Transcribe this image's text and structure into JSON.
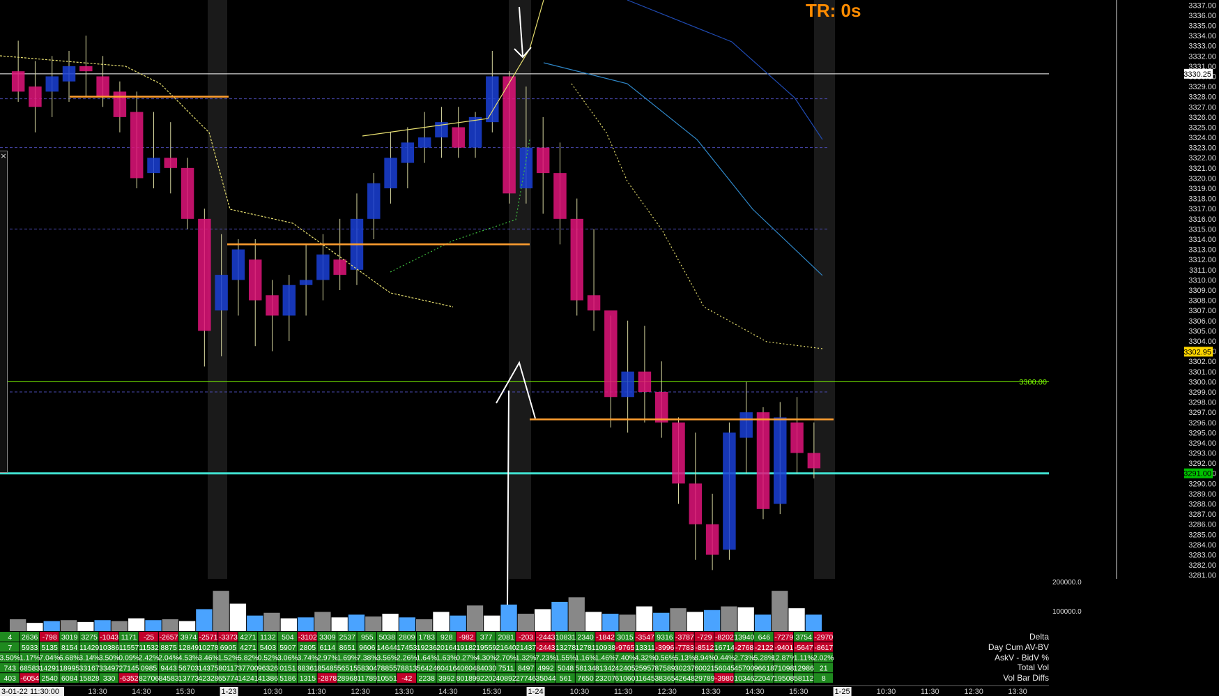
{
  "tr_label": "TR: 0s",
  "window_close_glyph": "×",
  "chart_data": {
    "type": "footprint_candlestick",
    "instrument_price_axis": {
      "ylim": [
        3280.5,
        3337.5
      ],
      "ticks": [
        "3337.00",
        "3336.00",
        "3335.00",
        "3334.00",
        "3333.00",
        "3332.00",
        "3331.00",
        "3330.00",
        "3329.00",
        "3328.00",
        "3327.00",
        "3326.00",
        "3325.00",
        "3324.00",
        "3323.00",
        "3322.00",
        "3321.00",
        "3320.00",
        "3319.00",
        "3318.00",
        "3317.00",
        "3316.00",
        "3315.00",
        "3314.00",
        "3313.00",
        "3312.00",
        "3311.00",
        "3310.00",
        "3309.00",
        "3308.00",
        "3307.00",
        "3306.00",
        "3305.00",
        "3304.00",
        "3303.00",
        "3302.00",
        "3301.00",
        "3300.00",
        "3299.00",
        "3298.00",
        "3297.00",
        "3296.00",
        "3295.00",
        "3294.00",
        "3293.00",
        "3292.00",
        "3291.00",
        "3290.00",
        "3289.00",
        "3288.00",
        "3287.00",
        "3286.00",
        "3285.00",
        "3284.00",
        "3283.00",
        "3282.00",
        "3281.00"
      ],
      "highlighted": [
        {
          "label": "3330.25",
          "value": 3330.25,
          "color": "#ffffff",
          "text_color": "#000000"
        },
        {
          "label": "3302.95",
          "value": 3302.95,
          "color": "#ffd700",
          "text_color": "#000000"
        },
        {
          "label": "3291.00",
          "value": 3291.0,
          "color": "#00c000",
          "text_color": "#000000"
        }
      ]
    },
    "volume_axis": {
      "ticks": [
        "200000.0",
        "100000.0"
      ]
    },
    "horizontal_levels": [
      {
        "label": "3300.00",
        "value": 3300.0,
        "color": "#7cfc00"
      },
      {
        "label": "",
        "value": 3291.0,
        "color": "#40e0d0"
      },
      {
        "label": "",
        "value": 3330.25,
        "color": "#ffffff"
      }
    ],
    "time_axis": [
      "3-01-22 11:30:00",
      "13:30",
      "14:30",
      "15:30",
      "1-23",
      "10:30",
      "11:30",
      "12:30",
      "13:30",
      "14:30",
      "15:30",
      "1-24",
      "10:30",
      "11:30",
      "12:30",
      "13:30",
      "14:30",
      "15:30",
      "1-25",
      "10:30",
      "11:30",
      "12:30",
      "13:30"
    ],
    "candles": [
      {
        "o": 3330.5,
        "h": 3333.5,
        "c": 3328.5,
        "l": 3327.5
      },
      {
        "o": 3329.0,
        "h": 3331.5,
        "c": 3327.0,
        "l": 3324.5
      },
      {
        "o": 3328.5,
        "h": 3332.0,
        "c": 3330.0,
        "l": 3326.0
      },
      {
        "o": 3329.5,
        "h": 3332.5,
        "c": 3331.0,
        "l": 3327.5
      },
      {
        "o": 3331.0,
        "h": 3334.0,
        "c": 3330.5,
        "l": 3328.0
      },
      {
        "o": 3330.0,
        "h": 3332.0,
        "c": 3328.0,
        "l": 3327.0
      },
      {
        "o": 3328.5,
        "h": 3329.5,
        "c": 3326.0,
        "l": 3324.5
      },
      {
        "o": 3326.5,
        "h": 3328.5,
        "c": 3320.0,
        "l": 3319.0
      },
      {
        "o": 3320.5,
        "h": 3326.5,
        "c": 3322.0,
        "l": 3319.0
      },
      {
        "o": 3322.0,
        "h": 3325.5,
        "c": 3321.0,
        "l": 3318.5
      },
      {
        "o": 3321.0,
        "h": 3322.0,
        "c": 3316.0,
        "l": 3315.0
      },
      {
        "o": 3316.0,
        "h": 3317.0,
        "c": 3305.0,
        "l": 3301.5
      },
      {
        "o": 3307.0,
        "h": 3314.5,
        "c": 3310.5,
        "l": 3302.5
      },
      {
        "o": 3310.0,
        "h": 3314.0,
        "c": 3313.0,
        "l": 3306.5
      },
      {
        "o": 3312.0,
        "h": 3314.0,
        "c": 3308.0,
        "l": 3303.5
      },
      {
        "o": 3308.5,
        "h": 3310.0,
        "c": 3306.5,
        "l": 3303.0
      },
      {
        "o": 3306.5,
        "h": 3310.5,
        "c": 3309.5,
        "l": 3304.0
      },
      {
        "o": 3309.5,
        "h": 3313.5,
        "c": 3310.0,
        "l": 3306.5
      },
      {
        "o": 3310.0,
        "h": 3314.5,
        "c": 3312.5,
        "l": 3308.0
      },
      {
        "o": 3312.0,
        "h": 3316.0,
        "c": 3310.5,
        "l": 3309.0
      },
      {
        "o": 3311.0,
        "h": 3318.5,
        "c": 3316.0,
        "l": 3309.5
      },
      {
        "o": 3316.0,
        "h": 3320.5,
        "c": 3319.5,
        "l": 3314.0
      },
      {
        "o": 3319.0,
        "h": 3324.5,
        "c": 3322.0,
        "l": 3317.5
      },
      {
        "o": 3321.5,
        "h": 3325.0,
        "c": 3323.5,
        "l": 3319.0
      },
      {
        "o": 3323.0,
        "h": 3326.5,
        "c": 3324.0,
        "l": 3321.5
      },
      {
        "o": 3324.0,
        "h": 3327.0,
        "c": 3325.5,
        "l": 3322.0
      },
      {
        "o": 3325.0,
        "h": 3327.0,
        "c": 3323.0,
        "l": 3322.0
      },
      {
        "o": 3323.0,
        "h": 3326.5,
        "c": 3326.0,
        "l": 3322.0
      },
      {
        "o": 3325.5,
        "h": 3332.5,
        "c": 3330.0,
        "l": 3324.5
      },
      {
        "o": 3330.0,
        "h": 3330.5,
        "c": 3318.5,
        "l": 3317.5
      },
      {
        "o": 3319.0,
        "h": 3329.0,
        "c": 3323.0,
        "l": 3317.5
      },
      {
        "o": 3323.0,
        "h": 3326.0,
        "c": 3320.5,
        "l": 3316.5
      },
      {
        "o": 3320.5,
        "h": 3323.5,
        "c": 3316.0,
        "l": 3313.5
      },
      {
        "o": 3316.0,
        "h": 3318.0,
        "c": 3308.0,
        "l": 3306.5
      },
      {
        "o": 3308.5,
        "h": 3315.0,
        "c": 3307.0,
        "l": 3305.0
      },
      {
        "o": 3307.0,
        "h": 3306.5,
        "c": 3298.5,
        "l": 3295.5
      },
      {
        "o": 3298.5,
        "h": 3306.0,
        "c": 3301.0,
        "l": 3295.0
      },
      {
        "o": 3301.0,
        "h": 3305.5,
        "c": 3299.0,
        "l": 3296.0
      },
      {
        "o": 3299.0,
        "h": 3302.0,
        "c": 3296.0,
        "l": 3294.5
      },
      {
        "o": 3296.0,
        "h": 3296.5,
        "c": 3290.0,
        "l": 3288.0
      },
      {
        "o": 3290.0,
        "h": 3295.0,
        "c": 3286.0,
        "l": 3282.5
      },
      {
        "o": 3286.0,
        "h": 3289.0,
        "c": 3283.0,
        "l": 3281.5
      },
      {
        "o": 3283.5,
        "h": 3296.0,
        "c": 3295.0,
        "l": 3282.5
      },
      {
        "o": 3294.5,
        "h": 3300.0,
        "c": 3297.0,
        "l": 3291.0
      },
      {
        "o": 3297.0,
        "h": 3297.5,
        "c": 3287.5,
        "l": 3286.5
      },
      {
        "o": 3288.0,
        "h": 3298.0,
        "c": 3296.5,
        "l": 3287.0
      },
      {
        "o": 3296.0,
        "h": 3298.5,
        "c": 3293.0,
        "l": 3291.0
      },
      {
        "o": 3293.0,
        "h": 3296.0,
        "c": 3291.5,
        "l": 3290.5
      }
    ],
    "volume_bars": [
      0.13,
      0.09,
      0.11,
      0.12,
      0.1,
      0.12,
      0.11,
      0.14,
      0.12,
      0.13,
      0.11,
      0.24,
      0.44,
      0.3,
      0.17,
      0.2,
      0.14,
      0.15,
      0.21,
      0.15,
      0.18,
      0.16,
      0.19,
      0.15,
      0.13,
      0.21,
      0.17,
      0.28,
      0.17,
      0.29,
      0.19,
      0.24,
      0.32,
      0.37,
      0.21,
      0.19,
      0.18,
      0.27,
      0.2,
      0.25,
      0.21,
      0.23,
      0.27,
      0.26,
      0.18,
      0.44,
      0.25,
      0.18
    ],
    "stats_rows": [
      {
        "label": "Delta",
        "values": [
          "4",
          "2636",
          "-798",
          "3019",
          "3275",
          "-1043",
          "1171",
          "-25",
          "-2657",
          "3974",
          "-2571",
          "-3373",
          "4271",
          "1132",
          "504",
          "-3102",
          "3309",
          "2537",
          "955",
          "5038",
          "2809",
          "1783",
          "928",
          "-982",
          "377",
          "2081",
          "-203",
          "-2443",
          "10831",
          "2340",
          "-1842",
          "3015",
          "-3547",
          "9316",
          "-3787",
          "-729",
          "-8202",
          "13940",
          "646",
          "-7279",
          "3754",
          "-2970"
        ]
      },
      {
        "label": "Day Cum AV-BV",
        "values": [
          "7",
          "5933",
          "5135",
          "8154",
          "11429",
          "10386",
          "11557",
          "11532",
          "8875",
          "12849",
          "10278",
          "6905",
          "4271",
          "5403",
          "5907",
          "2805",
          "6114",
          "8651",
          "9606",
          "14644",
          "17453",
          "19236",
          "20164",
          "19182",
          "19559",
          "21640",
          "21437",
          "-2443",
          "13278",
          "12781",
          "10938",
          "-9765",
          "13311",
          "-3996",
          "-7783",
          "-8512",
          "16714",
          "-2768",
          "-2122",
          "-9401",
          "-5647",
          "-8617"
        ]
      },
      {
        "label": "AskV - BidV %",
        "values": [
          "3.50%",
          "1.17%",
          "7.04%",
          "6.68%",
          "3.14%",
          "3.50%",
          "0.09%",
          "2.42%",
          "2.04%",
          "4.53%",
          "3.46%",
          "1.52%",
          "5.82%",
          "0.52%",
          "3.06%",
          "3.74%",
          "2.97%",
          "1.69%",
          "7.38%",
          "3.56%",
          "2.26%",
          "1.64%",
          "1.63%",
          "0.27%",
          "4.30%",
          "2.70%",
          "1.32%",
          "7.23%",
          "1.55%",
          "1.16%",
          "1.46%",
          "7.40%",
          "4.32%",
          "0.56%",
          "5.13%",
          "8.94%",
          "0.44%",
          "2.73%",
          "5.28%",
          "12.87%",
          "1.11%",
          "2.02%"
        ]
      },
      {
        "label": "Total Vol",
        "values": [
          "743",
          "68583",
          "14291",
          "18995",
          "33167",
          "33497",
          "27145",
          "0985",
          "9443",
          "56703",
          "14375",
          "80117",
          "37700",
          "96326",
          "0151",
          "88361",
          "85485",
          "56515",
          "58304",
          "78855",
          "78813",
          "56424",
          "60416",
          "40604",
          "84030",
          "7511",
          "8497",
          "4992",
          "5048",
          "58134",
          "81342",
          "42405",
          "25957",
          "87589",
          "30237",
          "60021",
          "56045",
          "45700",
          "96618",
          "71098",
          "12986",
          "21"
        ]
      },
      {
        "label": "Vol Bar Diffs",
        "values": [
          "403",
          "-6054",
          "2540",
          "6084",
          "15828",
          "330",
          "-6352",
          "82706",
          "84583",
          "13773",
          "42328",
          "65774",
          "14241",
          "41386",
          "5186",
          "1315",
          "-2878",
          "28968",
          "11789",
          "10551",
          "-42",
          "2238",
          "3992",
          "80189",
          "92202",
          "40892",
          "27746",
          "35044",
          "561",
          "7650",
          "23207",
          "61060",
          "11645",
          "38365",
          "42648",
          "29789",
          "-3980",
          "10346",
          "22047",
          "19508",
          "58112",
          "8"
        ]
      }
    ]
  }
}
